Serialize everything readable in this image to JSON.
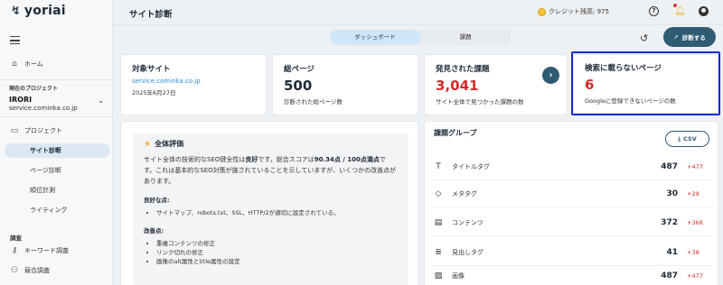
{
  "app": {
    "logo_text": "yoriai",
    "logo_mark": "↯"
  },
  "sidebar": {
    "home": "ホーム",
    "current_project_label": "現在のプロジェクト",
    "project_name": "IRORI",
    "project_domain": "service.cominka.co.jp",
    "project_section": "プロジェクト",
    "items": [
      {
        "label": "サイト診断",
        "active": true
      },
      {
        "label": "ページ診断",
        "active": false
      },
      {
        "label": "順位計測",
        "active": false
      },
      {
        "label": "ライティング",
        "active": false
      }
    ],
    "survey_label": "調査",
    "keyword": "キーワード調査",
    "competitor": "競合調査"
  },
  "header": {
    "title": "サイト診断",
    "credit": "クレジット残高: 975"
  },
  "tabs": [
    {
      "label": "ダッシュボード",
      "active": true
    },
    {
      "label": "課題",
      "active": false
    }
  ],
  "diagnose_button": "診断する",
  "cards": {
    "site": {
      "title": "対象サイト",
      "link": "service.cominka.co.jp",
      "date": "2025年6月27日"
    },
    "pages": {
      "title": "総ページ",
      "value": "500",
      "caption": "診断された総ページ数"
    },
    "issues": {
      "title": "発見された課題",
      "value": "3,041",
      "caption": "サイト全体で見つかった課題の数"
    },
    "unindexed": {
      "title": "検索に載らないページ",
      "value": "6",
      "caption": "Googleに登録できないページの数"
    }
  },
  "evaluation": {
    "title": "全体評価",
    "text_1": "サイト全体の技術的なSEO健全性は",
    "text_bold_1": "良好",
    "text_2": "です。総合スコアは",
    "text_bold_2": "90.34点 / 100点満点",
    "text_3": "です。これは基本的なSEO対策が施されていることを示していますが、いくつかの改善点があります。",
    "good_label": "良好な点:",
    "good_points": [
      "サイトマップ、robots.txt、SSL、HTTP/2が適切に設定されている。"
    ],
    "improve_label": "改善点:",
    "improve_points": [
      "重複コンテンツの修正",
      "リンク切れの修正",
      "画像のalt属性とtitle属性の設定"
    ]
  },
  "groups": {
    "title": "課題グループ",
    "csv": "CSV",
    "rows": [
      {
        "icon": "T",
        "label": "タイトルタグ",
        "count": "487",
        "diff": "+477"
      },
      {
        "icon": "◇",
        "label": "メタタグ",
        "count": "30",
        "diff": "+29"
      },
      {
        "icon": "▤",
        "label": "コンテンツ",
        "count": "372",
        "diff": "+368"
      },
      {
        "icon": "≣",
        "label": "見出しタグ",
        "count": "41",
        "diff": "+38"
      },
      {
        "icon": "▨",
        "label": "画像",
        "count": "487",
        "diff": "+477"
      }
    ]
  }
}
